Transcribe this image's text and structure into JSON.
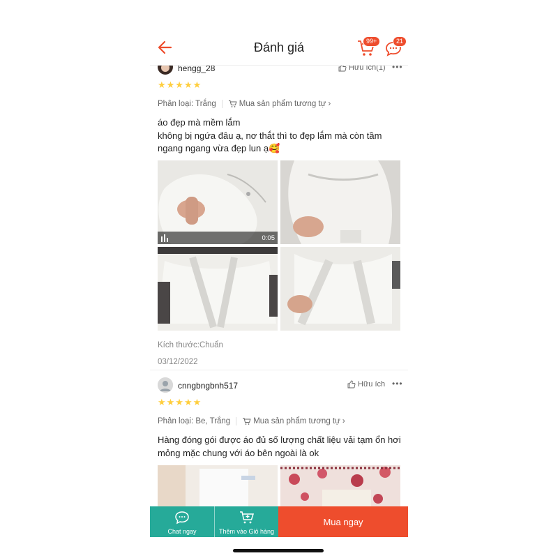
{
  "header": {
    "title": "Đánh giá",
    "cart_badge": "99+",
    "chat_badge": "21"
  },
  "reviews": [
    {
      "username": "hengg_28",
      "helpful": "Hữu ích(1)",
      "stars": "★★★★★",
      "variant_label": "Phân loại: Trắng",
      "buy_similar": "Mua sản phẩm tương tự",
      "content_lines": [
        "áo đẹp mà mềm lắm",
        "không bị ngứa đâu ạ, nơ thắt thì to đẹp lắm mà còn tầm",
        "ngang ngang vừa đẹp lun ạ🥰"
      ],
      "video_duration": "0:05",
      "size_label": "Kích thước:Chuẩn",
      "date": "03/12/2022"
    },
    {
      "username": "cnngbngbnh517",
      "helpful": "Hữu ích",
      "stars": "★★★★★",
      "variant_label": "Phân loại: Be, Trắng",
      "buy_similar": "Mua sản phẩm tương tự",
      "content_lines": [
        "Hàng đóng gói được áo đủ số lượng chất liệu vải tạm ổn hơi",
        "mỏng mặc chung với áo bên ngoài là ok"
      ]
    }
  ],
  "bottom_bar": {
    "chat_label": "Chat ngay",
    "add_cart_label": "Thêm vào Giỏ hàng",
    "buy_label": "Mua ngay"
  },
  "colors": {
    "brand": "#ee4d2d",
    "teal": "#26aa99",
    "star": "#ffce3d"
  }
}
